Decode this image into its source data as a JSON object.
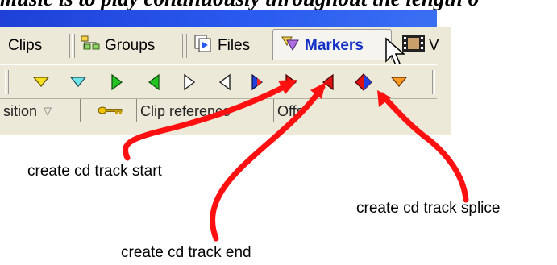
{
  "caption": "music is to play continuously throughout the length o",
  "tabs": {
    "clips": "Clips",
    "groups": "Groups",
    "files": "Files",
    "markers": "Markers",
    "v": "V"
  },
  "icons": {
    "groups": "groups-icon",
    "files": "files-icon",
    "markers": "markers-icon",
    "video": "video-icon"
  },
  "columns": {
    "position": "sition",
    "key": "key-icon",
    "clip_reference": "Clip reference",
    "offset": "Offs"
  },
  "toolbar_buttons": [
    "yellow-down-triangle",
    "cyan-down-triangle",
    "green-right-triangle",
    "green-left-triangle",
    "outline-right-triangle",
    "outline-left-triangle",
    "blue-red-right-triangle",
    "red-right-triangle",
    "red-left-triangle",
    "red-blue-diamond",
    "orange-down-triangle"
  ],
  "annotations": {
    "start": "create cd track start",
    "end": "create cd track end",
    "splice": "create cd track splice"
  },
  "colors": {
    "titlebar": "#2a5bf0",
    "arrow": "#ff1010",
    "panel": "#ece9d8"
  }
}
